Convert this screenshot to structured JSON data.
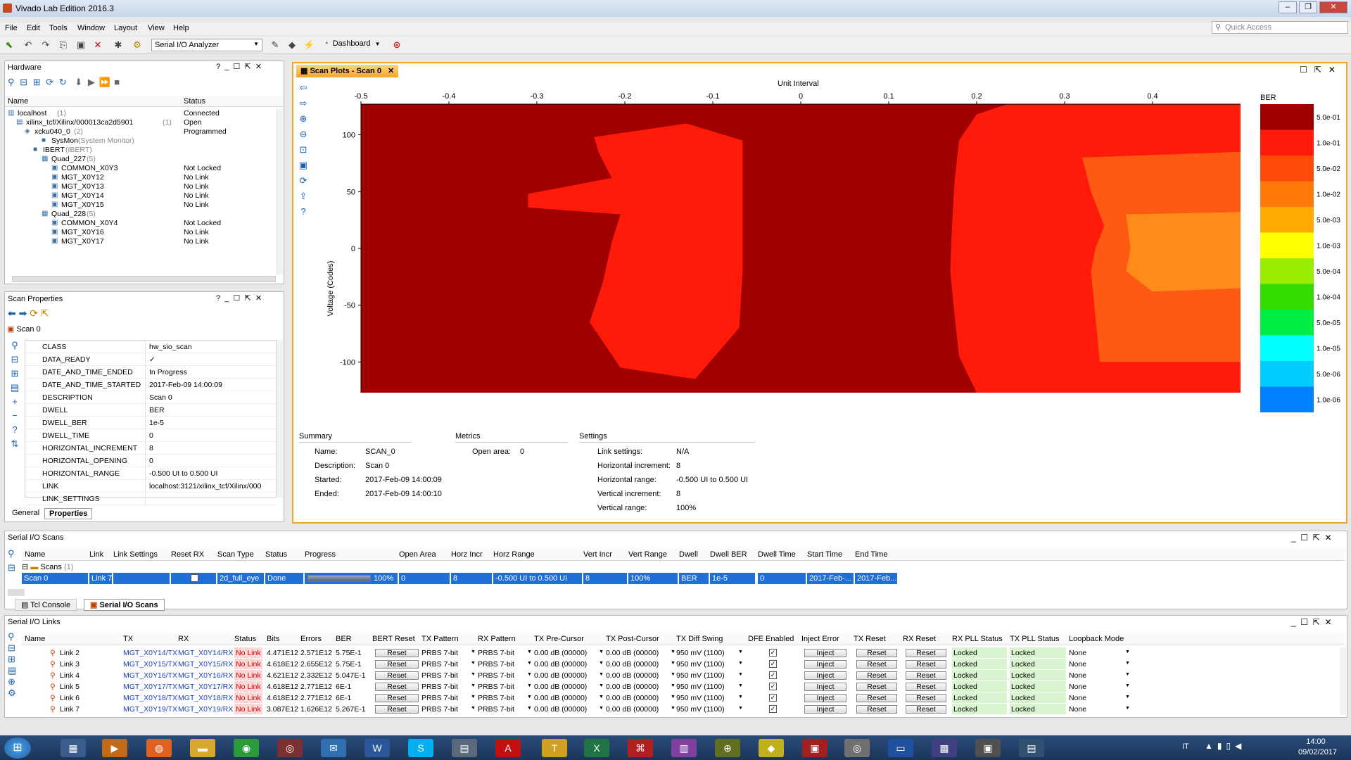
{
  "window": {
    "title": "Vivado Lab Edition 2016.3"
  },
  "menus": [
    "File",
    "Edit",
    "Tools",
    "Window",
    "Layout",
    "View",
    "Help"
  ],
  "quick_access": {
    "placeholder": "Quick Access"
  },
  "toolbar": {
    "layout_select": "Serial I/O Analyzer",
    "dashboard": "Dashboard"
  },
  "hardware": {
    "title": "Hardware",
    "cols": [
      "Name",
      "Status"
    ],
    "rows": [
      {
        "name": "localhost",
        "count": "(1)",
        "status": "Connected"
      },
      {
        "name": "xilinx_tcf/Xilinx/000013ca2d5901",
        "count": "(1)",
        "status": "Open"
      },
      {
        "name": "xcku040_0",
        "count": "(2)",
        "status": "Programmed"
      },
      {
        "name": "SysMon",
        "count": "(System Monitor)",
        "status": ""
      },
      {
        "name": "IBERT",
        "count": "(IBERT)",
        "status": ""
      },
      {
        "name": "Quad_227",
        "count": "(5)",
        "status": ""
      },
      {
        "name": "COMMON_X0Y3",
        "count": "",
        "status": "Not Locked"
      },
      {
        "name": "MGT_X0Y12",
        "count": "",
        "status": "No Link"
      },
      {
        "name": "MGT_X0Y13",
        "count": "",
        "status": "No Link"
      },
      {
        "name": "MGT_X0Y14",
        "count": "",
        "status": "No Link"
      },
      {
        "name": "MGT_X0Y15",
        "count": "",
        "status": "No Link"
      },
      {
        "name": "Quad_228",
        "count": "(5)",
        "status": ""
      },
      {
        "name": "COMMON_X0Y4",
        "count": "",
        "status": "Not Locked"
      },
      {
        "name": "MGT_X0Y16",
        "count": "",
        "status": "No Link"
      },
      {
        "name": "MGT_X0Y17",
        "count": "",
        "status": "No Link"
      }
    ]
  },
  "scan_props": {
    "title": "Scan Properties",
    "subject": "Scan 0",
    "rows": [
      {
        "k": "CLASS",
        "v": "hw_sio_scan"
      },
      {
        "k": "DATA_READY",
        "v": "✓"
      },
      {
        "k": "DATE_AND_TIME_ENDED",
        "v": "In Progress"
      },
      {
        "k": "DATE_AND_TIME_STARTED",
        "v": "2017-Feb-09 14:00:09"
      },
      {
        "k": "DESCRIPTION",
        "v": "Scan 0"
      },
      {
        "k": "DWELL",
        "v": "BER"
      },
      {
        "k": "DWELL_BER",
        "v": "1e-5"
      },
      {
        "k": "DWELL_TIME",
        "v": "0"
      },
      {
        "k": "HORIZONTAL_INCREMENT",
        "v": "8"
      },
      {
        "k": "HORIZONTAL_OPENING",
        "v": "0"
      },
      {
        "k": "HORIZONTAL_RANGE",
        "v": "-0.500 UI to 0.500 UI"
      },
      {
        "k": "LINK",
        "v": "localhost:3121/xilinx_tcf/Xilinx/000"
      },
      {
        "k": "LINK_SETTINGS",
        "v": ""
      }
    ],
    "tabs": [
      "General",
      "Properties"
    ]
  },
  "scan_plot": {
    "tab": "Scan Plots - Scan 0",
    "summary": {
      "title": "Summary",
      "name_label": "Name:",
      "name": "SCAN_0",
      "desc_label": "Description:",
      "desc": "Scan 0",
      "started_label": "Started:",
      "started": "2017-Feb-09 14:00:09",
      "ended_label": "Ended:",
      "ended": "2017-Feb-09 14:00:10"
    },
    "metrics": {
      "title": "Metrics",
      "open_label": "Open area:",
      "open": "0"
    },
    "settings": {
      "title": "Settings",
      "link_label": "Link settings:",
      "link": "N/A",
      "hinc_label": "Horizontal increment:",
      "hinc": "8",
      "hrange_label": "Horizontal range:",
      "hrange": "-0.500 UI to 0.500 UI",
      "vinc_label": "Vertical increment:",
      "vinc": "8",
      "vrange_label": "Vertical range:",
      "vrange": "100%"
    }
  },
  "chart_data": {
    "type": "heatmap",
    "title": "",
    "xlabel": "Unit Interval",
    "ylabel": "Voltage (Codes)",
    "xlim": [
      -0.5,
      0.5
    ],
    "ylim": [
      -127,
      127
    ],
    "xticks": [
      "-0.5",
      "-0.4",
      "-0.3",
      "-0.2",
      "-0.1",
      "0",
      "0.1",
      "0.2",
      "0.3",
      "0.4"
    ],
    "yticks": [
      "100",
      "50",
      "0",
      "-50",
      "-100"
    ],
    "legend_title": "BER",
    "legend": [
      {
        "label": "5.0e-01",
        "color": "#a00000"
      },
      {
        "label": "1.0e-01",
        "color": "#ff1a0a"
      },
      {
        "label": "5.0e-02",
        "color": "#ff4a0a"
      },
      {
        "label": "1.0e-02",
        "color": "#ff7a0a"
      },
      {
        "label": "5.0e-03",
        "color": "#ffaa00"
      },
      {
        "label": "1.0e-03",
        "color": "#ffff00"
      },
      {
        "label": "5.0e-04",
        "color": "#99ee00"
      },
      {
        "label": "1.0e-04",
        "color": "#33dd00"
      },
      {
        "label": "5.0e-05",
        "color": "#00ee44"
      },
      {
        "label": "1.0e-05",
        "color": "#00ffff"
      },
      {
        "label": "5.0e-06",
        "color": "#00ccff"
      },
      {
        "label": "1.0e-06",
        "color": "#0080ff"
      }
    ],
    "regions": [
      {
        "ber": "5.0e-01",
        "color": "#a00000"
      },
      {
        "ber": "1.0e-01",
        "color": "#ff1a0a"
      },
      {
        "ber": "5.0e-02",
        "color": "#ff5a14"
      },
      {
        "ber": "1.0e-02",
        "color": "#ff8c1a"
      }
    ]
  },
  "scans": {
    "title": "Serial I/O Scans",
    "cols": [
      "Name",
      "Link",
      "Link Settings",
      "Reset RX",
      "Scan Type",
      "Status",
      "Progress",
      "Open Area",
      "Horz Incr",
      "Horz Range",
      "Vert Incr",
      "Vert Range",
      "Dwell",
      "Dwell BER",
      "Dwell Time",
      "Start Time",
      "End Time"
    ],
    "group": "Scans",
    "group_count": "(1)",
    "row": {
      "name": "Scan 0",
      "link": "Link 7",
      "type": "2d_full_eye",
      "status": "Done",
      "progress": "100%",
      "open_area": "0",
      "horz_incr": "8",
      "horz_range": "-0.500 UI to 0.500 UI",
      "vert_incr": "8",
      "vert_range": "100%",
      "dwell": "BER",
      "dwell_ber": "1e-5",
      "dwell_time": "0",
      "start": "2017-Feb-...",
      "end": "2017-Feb..."
    },
    "progress_value": 1.0,
    "tabs": [
      "Tcl Console",
      "Serial I/O Scans"
    ]
  },
  "links": {
    "title": "Serial I/O Links",
    "cols": [
      "Name",
      "TX",
      "RX",
      "Status",
      "Bits",
      "Errors",
      "BER",
      "BERT Reset",
      "TX Pattern",
      "RX Pattern",
      "TX Pre-Cursor",
      "TX Post-Cursor",
      "TX Diff Swing",
      "DFE Enabled",
      "Inject Error",
      "TX Reset",
      "RX Reset",
      "RX PLL Status",
      "TX PLL Status",
      "Loopback Mode"
    ],
    "rows": [
      {
        "name": "Link 2",
        "tx": "MGT_X0Y14/TX",
        "rx": "MGT_X0Y14/RX",
        "status": "No Link",
        "bits": "4.471E12",
        "errors": "2.571E12",
        "ber": "5.75E-1"
      },
      {
        "name": "Link 3",
        "tx": "MGT_X0Y15/TX",
        "rx": "MGT_X0Y15/RX",
        "status": "No Link",
        "bits": "4.618E12",
        "errors": "2.655E12",
        "ber": "5.75E-1"
      },
      {
        "name": "Link 4",
        "tx": "MGT_X0Y16/TX",
        "rx": "MGT_X0Y16/RX",
        "status": "No Link",
        "bits": "4.621E12",
        "errors": "2.332E12",
        "ber": "5.047E-1"
      },
      {
        "name": "Link 5",
        "tx": "MGT_X0Y17/TX",
        "rx": "MGT_X0Y17/RX",
        "status": "No Link",
        "bits": "4.618E12",
        "errors": "2.771E12",
        "ber": "6E-1"
      },
      {
        "name": "Link 6",
        "tx": "MGT_X0Y18/TX",
        "rx": "MGT_X0Y18/RX",
        "status": "No Link",
        "bits": "4.618E12",
        "errors": "2.771E12",
        "ber": "6E-1"
      },
      {
        "name": "Link 7",
        "tx": "MGT_X0Y19/TX",
        "rx": "MGT_X0Y19/RX",
        "status": "No Link",
        "bits": "3.087E12",
        "errors": "1.626E12",
        "ber": "5.267E-1"
      }
    ],
    "common": {
      "reset": "Reset",
      "pattern": "PRBS 7-bit",
      "pre": "0.00 dB (00000)",
      "post": "0.00 dB (00000)",
      "swing": "950 mV (1100)",
      "inject": "Inject",
      "pll": "Locked",
      "loop": "None"
    }
  },
  "taskbar": {
    "lang": "IT",
    "time": "14:00",
    "date": "09/02/2017"
  }
}
